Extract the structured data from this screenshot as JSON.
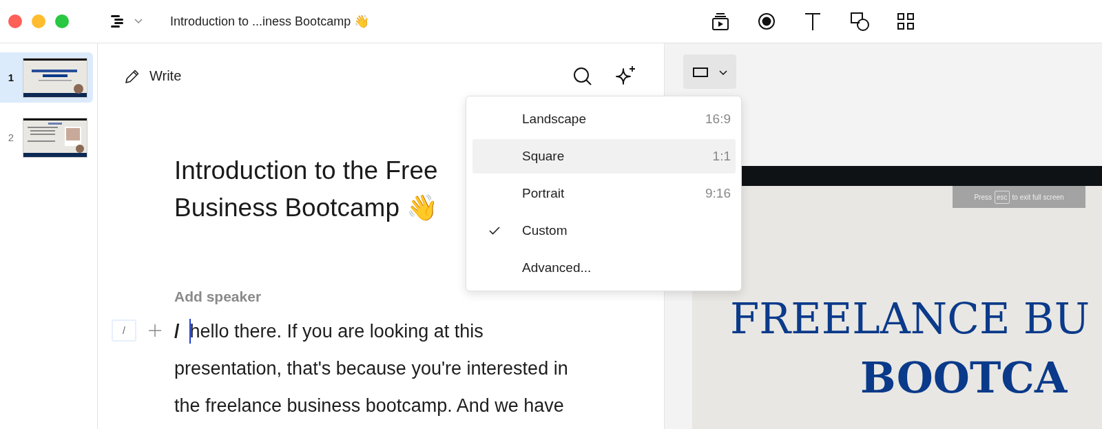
{
  "window": {
    "title": "Introduction to ...iness Bootcamp 👋"
  },
  "slides": [
    {
      "number": "1",
      "selected": true
    },
    {
      "number": "2",
      "selected": false
    }
  ],
  "editor": {
    "mode": "Write",
    "heading_lines": [
      "Introduction to the Free",
      "Business Bootcamp 👋"
    ],
    "speaker_placeholder": "Add speaker",
    "block_handle": "/",
    "paragraph": "**/**  hello there. If you are looking at this presentation, that's because you're interested in the freelance business bootcamp. And we have"
  },
  "aspect_menu": {
    "items": [
      {
        "label": "Landscape",
        "ratio": "16:9",
        "highlighted": false,
        "checked": false
      },
      {
        "label": "Square",
        "ratio": "1:1",
        "highlighted": true,
        "checked": false
      },
      {
        "label": "Portrait",
        "ratio": "9:16",
        "highlighted": false,
        "checked": false
      },
      {
        "label": "Custom",
        "highlighted": false,
        "checked": true
      },
      {
        "label": "Advanced...",
        "highlighted": false,
        "checked": false
      }
    ]
  },
  "preview": {
    "toast": {
      "before": "Press",
      "key": "esc",
      "after": "to exit full screen"
    },
    "title_lines": [
      "FREELANCE BU",
      "BOOTCA"
    ]
  }
}
